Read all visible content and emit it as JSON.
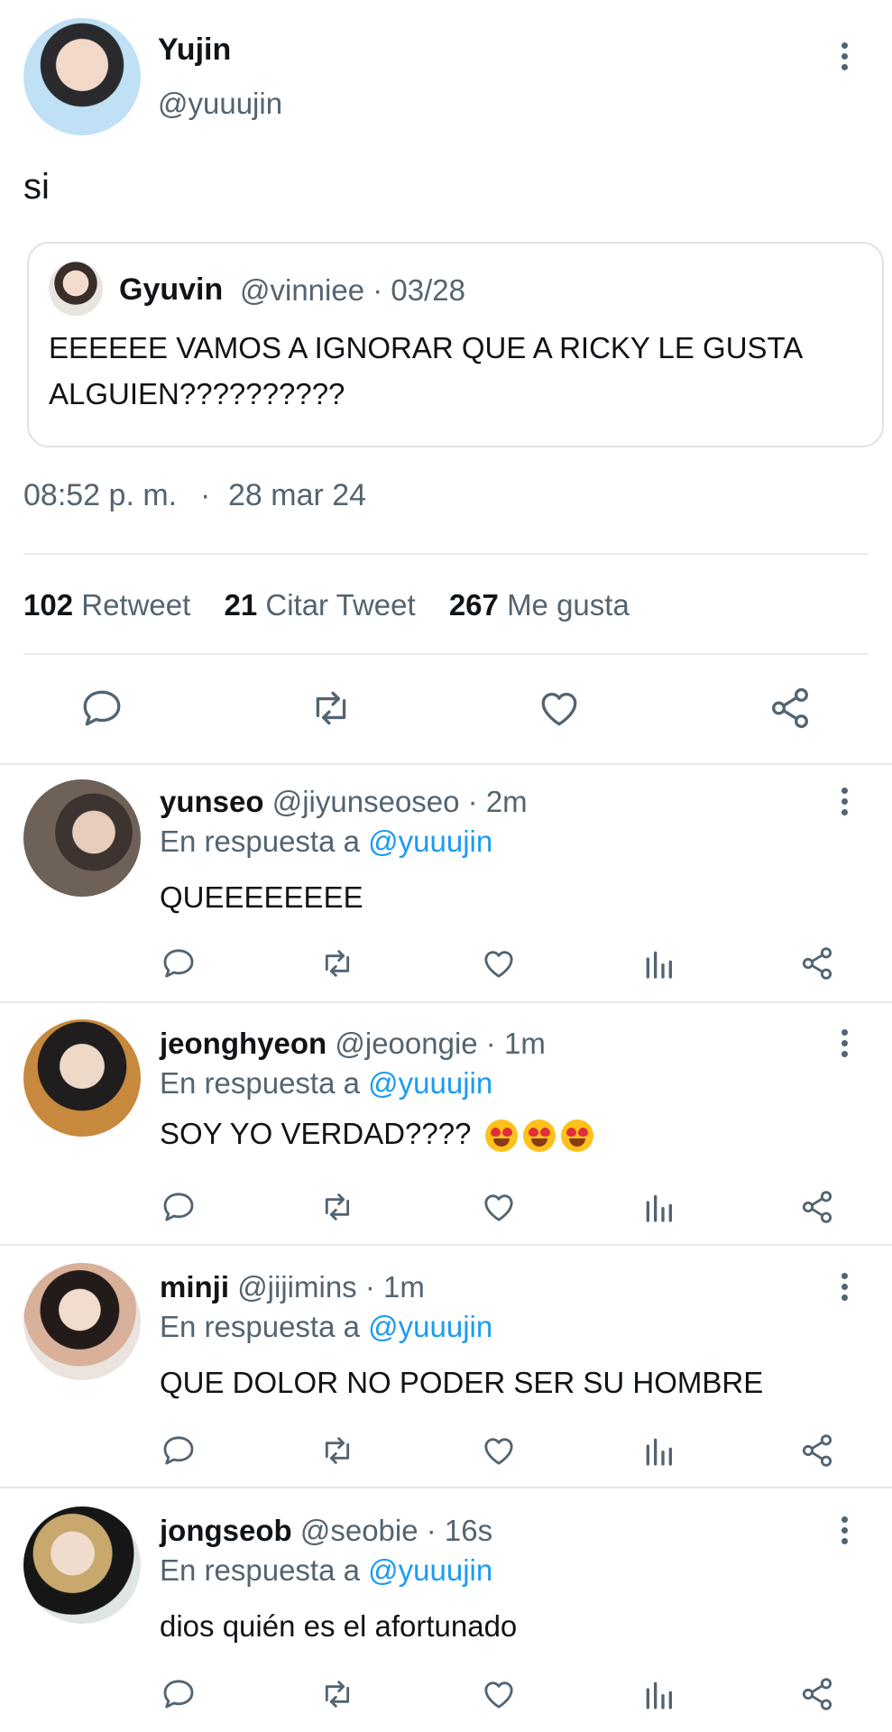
{
  "tweet": {
    "author_name": "Yujin",
    "author_handle": "@yuuujin",
    "text": "si",
    "quote": {
      "name": "Gyuvin",
      "meta": "@vinniee · 03/28",
      "text_line1": "EEEEEE VAMOS A IGNORAR QUE A RICKY LE GUSTA",
      "text_line2": "ALGUIEN??????????"
    },
    "time": "08:52 p. m.",
    "dot": "·",
    "date": "28 mar 24",
    "stats": {
      "retweets_count": "102",
      "retweets_label": "Retweet",
      "quotes_count": "21",
      "quotes_label": "Citar Tweet",
      "likes_count": "267",
      "likes_label": "Me gusta"
    },
    "actions": [
      "reply-icon",
      "retweet-icon",
      "like-icon",
      "share-icon"
    ]
  },
  "replies": [
    {
      "name": "yunseo",
      "meta": "@jiyunseoseo · 2m",
      "replying_prefix": "En respuesta a",
      "replying_to": "@yuuujin",
      "text": "QUEEEEEEEE",
      "avatar_color": "#6e6158"
    },
    {
      "name": "jeonghyeon",
      "meta": "@jeoongie · 1m",
      "replying_prefix": "En respuesta a",
      "replying_to": "@yuuujin",
      "text": "SOY YO VERDAD????",
      "emoji": "heart-eyes-emoji",
      "avatar_color": "#c7893d"
    },
    {
      "name": "minji",
      "meta": "@jijimins · 1m",
      "replying_prefix": "En respuesta a",
      "replying_to": "@yuuujin",
      "text": "QUE DOLOR NO PODER SER SU HOMBRE",
      "avatar_color": "#4a3a35"
    },
    {
      "name": "jongseob",
      "meta": "@seobie · 16s",
      "replying_prefix": "En respuesta a",
      "replying_to": "@yuuujin",
      "text": "dios quién es el afortunado",
      "avatar_color": "#b9a58a"
    }
  ],
  "colors": {
    "accent": "#1d9bf0",
    "muted": "#536471",
    "text": "#0f1419",
    "divider": "#e6e9eb"
  }
}
